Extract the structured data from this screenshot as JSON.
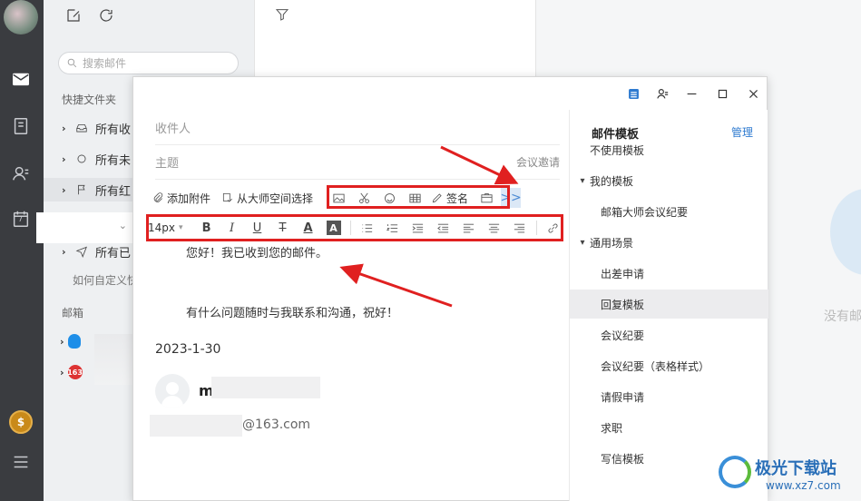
{
  "nav": {
    "icons": [
      "mail-icon",
      "contacts-book-icon",
      "address-book-icon",
      "calendar-icon",
      "coin-icon",
      "menu-icon"
    ],
    "calendar_day": "7",
    "coin_symbol": "$"
  },
  "folders": {
    "search_placeholder": "搜索邮件",
    "quick_folders_title": "快捷文件夹",
    "items": [
      "所有收",
      "所有未",
      "所有红",
      "所有已"
    ],
    "help_text": "如何自定义快",
    "mailbox_title": "邮箱",
    "badge_163": "163"
  },
  "reading": {
    "empty_text": "没有邮"
  },
  "compose": {
    "to_placeholder": "收件人",
    "subject_placeholder": "主题",
    "meeting_invite": "会议邀请",
    "attach_label": "添加附件",
    "space_label": "从大师空间选择",
    "signature_label": "签名",
    "more_label": ">>",
    "font_size": "14px",
    "body_line1": "您好！我已收到您的邮件。",
    "body_line2": "有什么问题随时与我联系和沟通，祝好！",
    "date": "2023-1-30",
    "sig_name_initial": "m",
    "sig_email_suffix": "@163.com"
  },
  "templates": {
    "title": "邮件模板",
    "manage": "管理",
    "items": [
      {
        "label": "不使用模板",
        "indent": false,
        "arrow": ""
      },
      {
        "label": "我的模板",
        "indent": false,
        "arrow": "▾"
      },
      {
        "label": "邮箱大师会议纪要",
        "indent": true,
        "arrow": ""
      },
      {
        "label": "通用场景",
        "indent": false,
        "arrow": "▾"
      },
      {
        "label": "出差申请",
        "indent": true,
        "arrow": ""
      },
      {
        "label": "回复模板",
        "indent": true,
        "arrow": "",
        "selected": true
      },
      {
        "label": "会议纪要",
        "indent": true,
        "arrow": ""
      },
      {
        "label": "会议纪要（表格样式）",
        "indent": true,
        "arrow": ""
      },
      {
        "label": "请假申请",
        "indent": true,
        "arrow": ""
      },
      {
        "label": "求职",
        "indent": true,
        "arrow": ""
      },
      {
        "label": "写信模板",
        "indent": true,
        "arrow": ""
      }
    ]
  },
  "watermark": {
    "title": "极光下载站",
    "url": "www.xz7.com"
  },
  "colors": {
    "rail": "#3a3c40",
    "accent": "#2f7bd0",
    "annotation": "#e02020"
  }
}
